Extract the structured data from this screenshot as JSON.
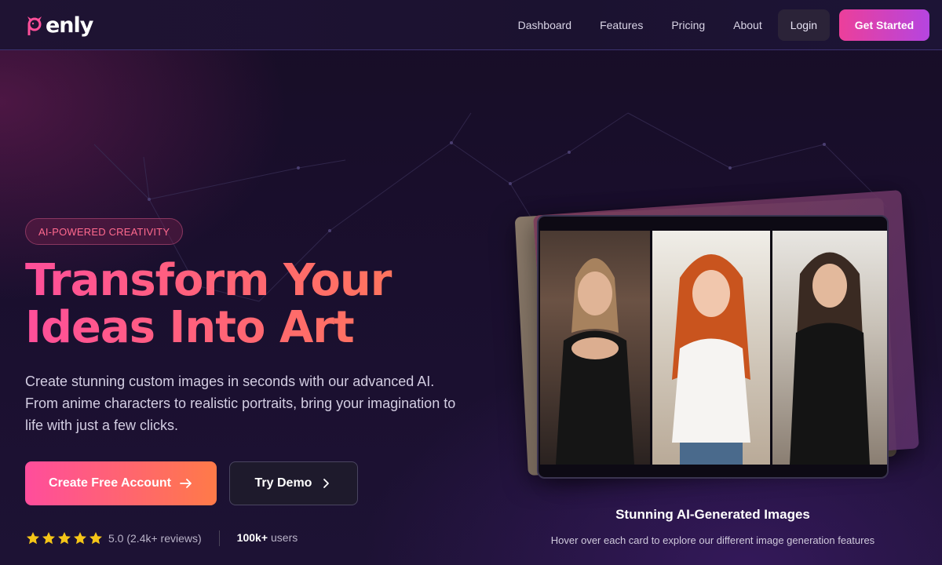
{
  "brand": {
    "name": "enly",
    "logo_icon": "devil-horns-p-icon"
  },
  "nav": {
    "links": [
      "Dashboard",
      "Features",
      "Pricing",
      "About"
    ],
    "login_label": "Login",
    "cta_label": "Get Started"
  },
  "hero": {
    "badge": "AI-POWERED CREATIVITY",
    "headline_line1": "Transform Your",
    "headline_line2": "Ideas Into Art",
    "description": "Create stunning custom images in seconds with our advanced AI. From anime characters to realistic portraits, bring your imagination to life with just a few clicks.",
    "primary_cta": "Create Free Account",
    "secondary_cta": "Try Demo",
    "rating": {
      "stars": 5,
      "text": "5.0 (2.4k+ reviews)"
    },
    "users": {
      "count": "100k+",
      "label": "users"
    }
  },
  "showcase": {
    "title": "Stunning AI-Generated Images",
    "subtitle": "Hover over each card to explore our different image generation features"
  },
  "colors": {
    "accent_pink": "#ff4d9c",
    "accent_orange": "#ff7a48",
    "accent_purple": "#b545e0",
    "background": "#1a0f2e"
  }
}
